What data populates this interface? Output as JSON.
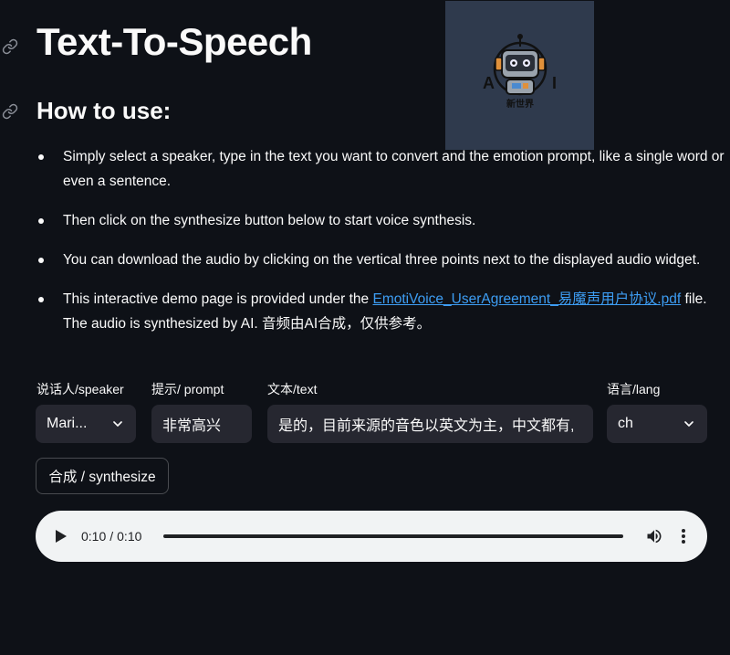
{
  "page": {
    "title": "Text-To-Speech",
    "subtitle": "How to use:"
  },
  "logo": {
    "icon": "robot-logo-icon",
    "letters": [
      "A",
      "I"
    ],
    "caption": "新世界"
  },
  "instructions": [
    {
      "text": "Simply select a speaker, type in the text you want to convert and the emotion prompt, like a single word or even a sentence."
    },
    {
      "text": "Then click on the synthesize button below to start voice synthesis."
    },
    {
      "text": "You can download the audio by clicking on the vertical three points next to the displayed audio widget."
    },
    {
      "prefix": "This interactive demo page is provided under the ",
      "link": "EmotiVoice_UserAgreement_易魔声用户协议.pdf",
      "suffix": " file. The audio is synthesized by AI. 音频由AI合成，仅供参考。"
    }
  ],
  "form": {
    "speaker": {
      "label": "说话人/speaker",
      "value": "Mari..."
    },
    "prompt": {
      "label": "提示/ prompt",
      "value": "非常高兴"
    },
    "text": {
      "label": "文本/text",
      "value": "是的，目前来源的音色以英文为主，中文都有,"
    },
    "lang": {
      "label": "语言/lang",
      "value": "ch"
    }
  },
  "synthesize_button": "合成 / synthesize",
  "audio": {
    "current_time": "0:10",
    "separator": "/",
    "duration": "0:10",
    "progress": 1.0
  },
  "colors": {
    "background": "#0e1117",
    "input": "#262730",
    "link": "#3d9df3",
    "player": "#f1f3f4"
  }
}
